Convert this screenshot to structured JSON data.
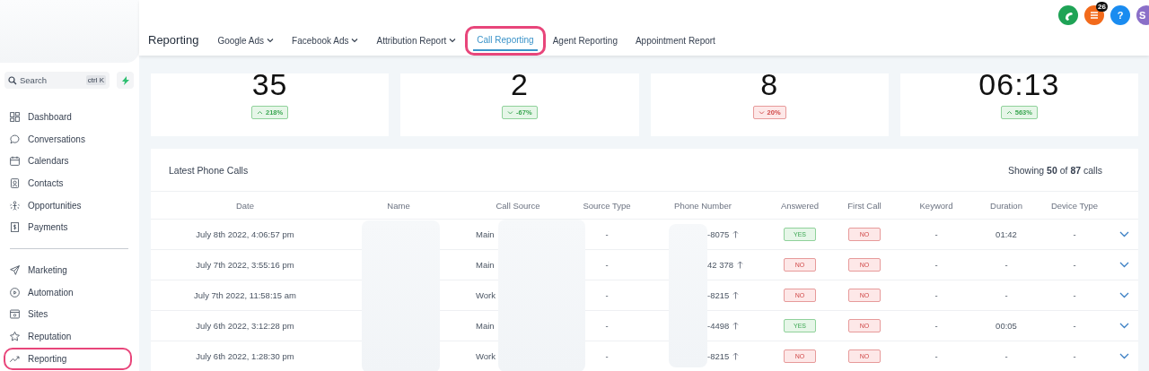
{
  "sidebar": {
    "search": {
      "placeholder": "Search",
      "shortcut": "ctrl K"
    },
    "items": [
      {
        "label": "Dashboard",
        "selected": false
      },
      {
        "label": "Conversations",
        "selected": false
      },
      {
        "label": "Calendars",
        "selected": false
      },
      {
        "label": "Contacts",
        "selected": false
      },
      {
        "label": "Opportunities",
        "selected": false
      },
      {
        "label": "Payments",
        "selected": false
      },
      {
        "kind": "divider"
      },
      {
        "label": "Marketing",
        "selected": false
      },
      {
        "label": "Automation",
        "selected": false
      },
      {
        "label": "Sites",
        "selected": false
      },
      {
        "label": "Reputation",
        "selected": false
      },
      {
        "label": "Reporting",
        "selected": true
      }
    ]
  },
  "header": {
    "title": "Reporting",
    "tabs": [
      {
        "label": "Google Ads",
        "dropdown": true,
        "selected": false
      },
      {
        "label": "Facebook Ads",
        "dropdown": true,
        "selected": false
      },
      {
        "label": "Attribution Report",
        "dropdown": true,
        "selected": false
      },
      {
        "label": "Call Reporting",
        "dropdown": false,
        "selected": true
      },
      {
        "label": "Agent Reporting",
        "dropdown": false,
        "selected": false
      },
      {
        "label": "Appointment Report",
        "dropdown": false,
        "selected": false
      }
    ],
    "actions": [
      {
        "kind": "phone",
        "color": "#1fa356"
      },
      {
        "kind": "list",
        "color": "#f26a1b",
        "badge": "26"
      },
      {
        "kind": "help",
        "color": "#1a8cf0",
        "text": "?"
      },
      {
        "kind": "avatar",
        "color": "#8a6fc8",
        "text": "S"
      }
    ]
  },
  "stats": [
    {
      "value": "35",
      "change": "218%",
      "rising": true,
      "positive": true
    },
    {
      "value": "2",
      "change": "-67%",
      "rising": false,
      "positive": true
    },
    {
      "value": "8",
      "change": "20%",
      "rising": false,
      "positive": false
    },
    {
      "value": "06:13",
      "change": "563%",
      "rising": true,
      "positive": true
    }
  ],
  "calls": {
    "title": "Latest Phone Calls",
    "summary": "Showing **50** of **87** calls",
    "columns": [
      "Date",
      "Name",
      "Call Source",
      "Source Type",
      "Phone Number",
      "Answered",
      "First Call",
      "Keyword",
      "Duration",
      "Device Type"
    ],
    "rows": [
      {
        "date": "July 8th 2022, 4:06:57 pm",
        "call_source": "Main",
        "source_type": "-",
        "phone": "-8075",
        "answered": {
          "label": "YES",
          "positive": true
        },
        "first_call": {
          "label": "NO",
          "positive": false
        },
        "keyword": "-",
        "duration": "01:42",
        "device_type": "-"
      },
      {
        "date": "July 7th 2022, 3:55:16 pm",
        "call_source": "Main",
        "source_type": "-",
        "phone": "42 378",
        "answered": {
          "label": "NO",
          "positive": false
        },
        "first_call": {
          "label": "NO",
          "positive": false
        },
        "keyword": "-",
        "duration": "-",
        "device_type": "-"
      },
      {
        "date": "July 7th 2022, 11:58:15 am",
        "call_source": "Work",
        "source_type": "-",
        "phone": "-8215",
        "answered": {
          "label": "NO",
          "positive": false
        },
        "first_call": {
          "label": "NO",
          "positive": false
        },
        "keyword": "-",
        "duration": "-",
        "device_type": "-"
      },
      {
        "date": "July 6th 2022, 3:12:28 pm",
        "call_source": "Main",
        "source_type": "-",
        "phone": "-4498",
        "answered": {
          "label": "YES",
          "positive": true
        },
        "first_call": {
          "label": "NO",
          "positive": false
        },
        "keyword": "-",
        "duration": "00:05",
        "device_type": "-"
      },
      {
        "date": "July 6th 2022, 1:28:30 pm",
        "call_source": "Work",
        "source_type": "-",
        "phone": "-8215",
        "answered": {
          "label": "NO",
          "positive": false
        },
        "first_call": {
          "label": "NO",
          "positive": false
        },
        "keyword": "-",
        "duration": "-",
        "device_type": "-"
      }
    ]
  }
}
